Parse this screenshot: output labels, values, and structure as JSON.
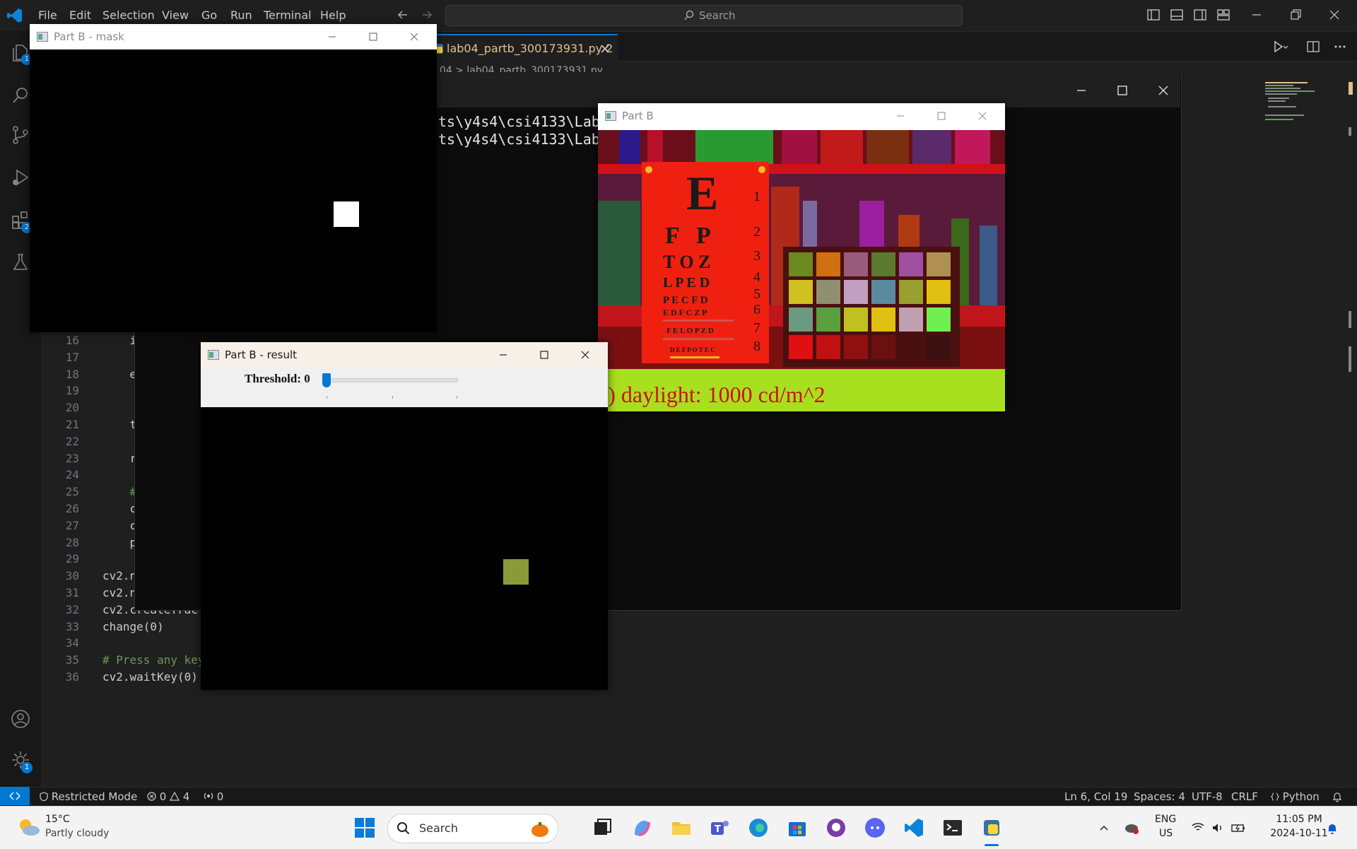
{
  "menu": [
    "File",
    "Edit",
    "Selection",
    "View",
    "Go",
    "Run",
    "Terminal",
    "Help"
  ],
  "search": {
    "label": "Search"
  },
  "activity_badges": {
    "explorer": "1",
    "extensions": "2",
    "settings": "1"
  },
  "editor": {
    "tab_label": "lab04_partb_300173931.py 2",
    "breadcrumb": "ab 04 > lab04_partb_300173931.py",
    "lines": [
      {
        "n": "16",
        "code": "    i"
      },
      {
        "n": "17",
        "code": ""
      },
      {
        "n": "18",
        "code": "    e"
      },
      {
        "n": "19",
        "code": ""
      },
      {
        "n": "20",
        "code": ""
      },
      {
        "n": "21",
        "code": "    t"
      },
      {
        "n": "22",
        "code": ""
      },
      {
        "n": "23",
        "code": "    r"
      },
      {
        "n": "24",
        "code": ""
      },
      {
        "n": "25",
        "code": "    #"
      },
      {
        "n": "26",
        "code": "    c"
      },
      {
        "n": "27",
        "code": "    c"
      },
      {
        "n": "28",
        "code": "    p"
      },
      {
        "n": "29",
        "code": ""
      },
      {
        "n": "30",
        "code": "cv2.n"
      },
      {
        "n": "31",
        "code": "cv2.n"
      },
      {
        "n": "32",
        "code": "cv2.createTrac"
      },
      {
        "n": "33",
        "code": "change(0)"
      },
      {
        "n": "34",
        "code": ""
      },
      {
        "n": "35",
        "code": "# Press any key"
      },
      {
        "n": "36",
        "code": "cv2.waitKey(0)"
      }
    ]
  },
  "terminal": {
    "line1": "ts\\y4s4\\csi4133\\Lab",
    "line2": "ts\\y4s4\\csi4133\\Lab"
  },
  "mask_window": {
    "title": "Part B - mask"
  },
  "partb_window": {
    "title": "Part B",
    "caption": "a) daylight: 1000 cd/m^2",
    "chart_letters": [
      "E",
      "F P",
      "T O Z",
      "L P E D",
      "P E C F D",
      "E D F C Z P",
      "F E L O P Z D",
      "D E F P O T E C"
    ],
    "chart_numbers": [
      "1",
      "2",
      "3",
      "4",
      "5",
      "6",
      "7",
      "8"
    ]
  },
  "result_window": {
    "title": "Part B - result",
    "trackbar_label": "Threshold: 0",
    "threshold_value": 0
  },
  "statusbar": {
    "restricted": "Restricted Mode",
    "errors": "0",
    "warnings": "4",
    "ports": "0",
    "position": "Ln 6, Col 19",
    "spaces": "Spaces: 4",
    "encoding": "UTF-8",
    "eol": "CRLF",
    "language": "Python"
  },
  "taskbar": {
    "weather_temp": "15°C",
    "weather_desc": "Partly cloudy",
    "search_label": "Search",
    "lang1": "ENG",
    "lang2": "US",
    "time": "11:05 PM",
    "date": "2024-10-11"
  },
  "colors": {
    "accent": "#0078d4",
    "tab_modified": "#e2c08d",
    "result_square": "#8a9a38"
  }
}
